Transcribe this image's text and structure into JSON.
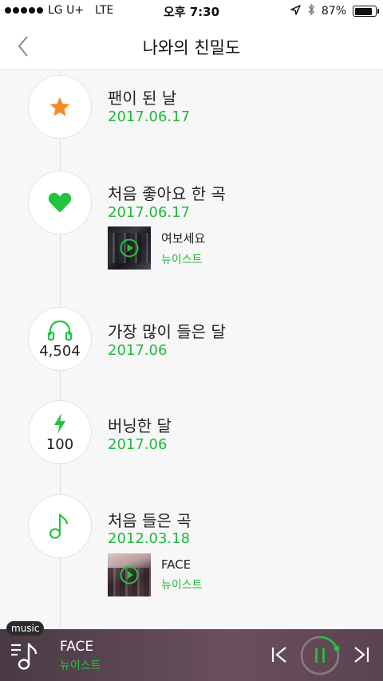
{
  "status_bar": {
    "carrier": "LG U+",
    "network": "LTE",
    "time": "오후 7:30",
    "battery": "87%",
    "battery_level": 0.87
  },
  "header": {
    "title": "나와의 친밀도",
    "back_icon": "chevron-left-icon"
  },
  "timeline": [
    {
      "title": "팬이 된 날",
      "date": "2017.06.17",
      "icon": "star-icon",
      "icon_color": "#f28c28"
    },
    {
      "title": "처음 좋아요 한 곡",
      "date": "2017.06.17",
      "icon": "heart-icon",
      "song": {
        "title": "여보세요",
        "artist": "뉴이스트"
      }
    },
    {
      "title": "가장 많이 들은 달",
      "date": "2017.06",
      "icon": "headphones-icon",
      "count": "4,504"
    },
    {
      "title": "버닝한 달",
      "date": "2017.06",
      "icon": "lightning-icon",
      "count": "100"
    },
    {
      "title": "처음 들은 곡",
      "date": "2012.03.18",
      "icon": "music-note-icon",
      "song": {
        "title": "FACE",
        "artist": "뉴이스트"
      }
    }
  ],
  "player": {
    "tab_label": "music",
    "song_title": "FACE",
    "artist": "뉴이스트"
  },
  "colors": {
    "accent_green": "#21b73c",
    "star_orange": "#f28c28"
  }
}
